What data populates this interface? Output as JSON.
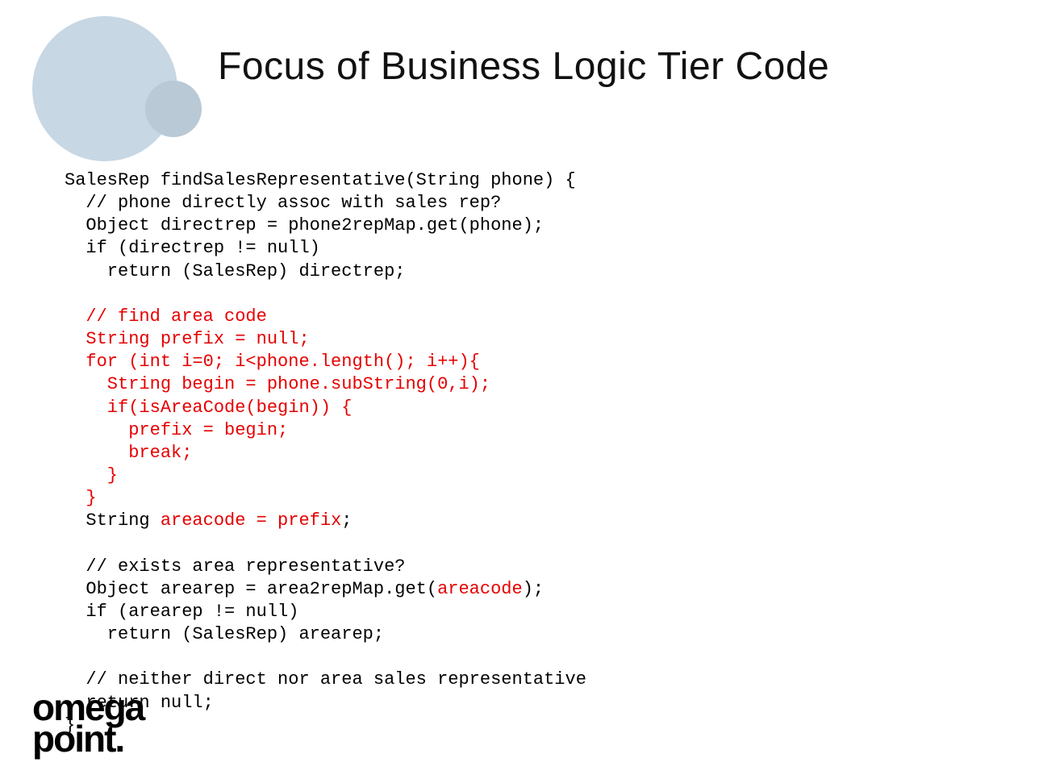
{
  "title": "Focus of Business Logic Tier Code",
  "logo": {
    "line1": "omega",
    "line2": "point."
  },
  "code": {
    "l01": "SalesRep findSalesRepresentative(String phone) {",
    "l02": "  // phone directly assoc with sales rep?",
    "l03": "  Object directrep = phone2repMap.get(phone);",
    "l04": "  if (directrep != null)",
    "l05": "    return (SalesRep) directrep;",
    "l06": "",
    "l07": "  // find area code",
    "l08": "  String prefix = null;",
    "l09": "  for (int i=0; i<phone.length(); i++){",
    "l10": "    String begin = phone.subString(0,i);",
    "l11": "    if(isAreaCode(begin)) {",
    "l12": "      prefix = begin;",
    "l13": "      break;",
    "l14": "    }",
    "l15": "  }",
    "l16a": "  String ",
    "l16b": "areacode = prefix",
    "l16c": ";",
    "l17": "",
    "l18": "  // exists area representative?",
    "l19a": "  Object arearep = area2repMap.get(",
    "l19b": "areacode",
    "l19c": ");",
    "l20": "  if (arearep != null)",
    "l21": "    return (SalesRep) arearep;",
    "l22": "",
    "l23": "  // neither direct nor area sales representative",
    "l24": "  return null;",
    "l25": "}"
  }
}
